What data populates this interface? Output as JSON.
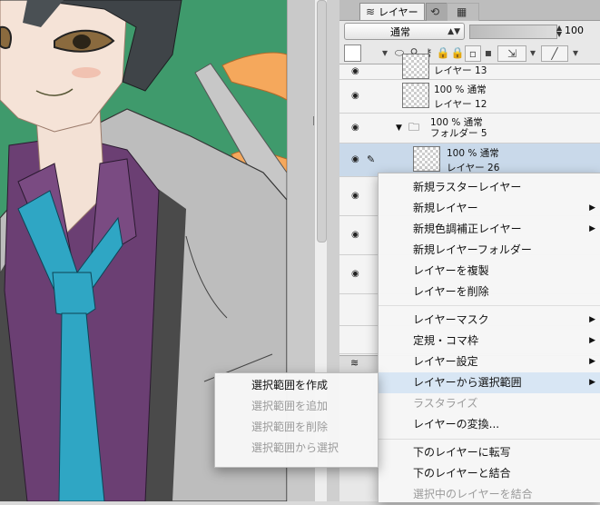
{
  "panel": {
    "tabs": [
      {
        "label": "レイヤー",
        "icon": "layers-icon"
      },
      {
        "label": "",
        "icon": "history-icon"
      },
      {
        "label": "",
        "icon": "navigator-icon"
      }
    ],
    "blend_mode": "通常",
    "opacity": "100",
    "layers": [
      {
        "name": "レイヤー 13",
        "mode": "",
        "visible": true
      },
      {
        "name": "レイヤー 12",
        "mode": "100 % 通常",
        "visible": true
      },
      {
        "name": "フォルダー 5",
        "mode": "100 % 通常",
        "visible": true,
        "folder": true
      },
      {
        "name": "レイヤー 26",
        "mode": "100 % 通常",
        "visible": true,
        "selected": true
      }
    ]
  },
  "context_menu": {
    "items": [
      {
        "label": "新規ラスターレイヤー",
        "disabled": false,
        "submenu": false
      },
      {
        "label": "新規レイヤー",
        "disabled": false,
        "submenu": true
      },
      {
        "label": "新規色調補正レイヤー",
        "disabled": false,
        "submenu": true
      },
      {
        "label": "新規レイヤーフォルダー",
        "disabled": false,
        "submenu": false
      },
      {
        "label": "レイヤーを複製",
        "disabled": false,
        "submenu": false
      },
      {
        "label": "レイヤーを削除",
        "disabled": false,
        "submenu": false
      },
      {
        "label": "レイヤーマスク",
        "disabled": false,
        "submenu": true
      },
      {
        "label": "定規・コマ枠",
        "disabled": false,
        "submenu": true
      },
      {
        "label": "レイヤー設定",
        "disabled": false,
        "submenu": true
      },
      {
        "label": "レイヤーから選択範囲",
        "disabled": false,
        "submenu": true,
        "highlighted": true
      },
      {
        "label": "ラスタライズ",
        "disabled": true,
        "submenu": false
      },
      {
        "label": "レイヤーの変換...",
        "disabled": false,
        "submenu": false
      },
      {
        "label": "下のレイヤーに転写",
        "disabled": false,
        "submenu": false
      },
      {
        "label": "下のレイヤーと結合",
        "disabled": false,
        "submenu": false
      },
      {
        "label": "選択中のレイヤーを結合",
        "disabled": true,
        "submenu": false
      }
    ]
  },
  "submenu": {
    "items": [
      {
        "label": "選択範囲を作成",
        "disabled": false
      },
      {
        "label": "選択範囲を追加",
        "disabled": true
      },
      {
        "label": "選択範囲を削除",
        "disabled": true
      },
      {
        "label": "選択範囲から選択",
        "disabled": true
      }
    ]
  },
  "colors": {
    "canvas_bg": "#3f9a6c",
    "shirt": "#6b3f73",
    "tie": "#2fa6c4",
    "jacket": "#b9b9b9",
    "highlight": "#d8e6f4"
  }
}
